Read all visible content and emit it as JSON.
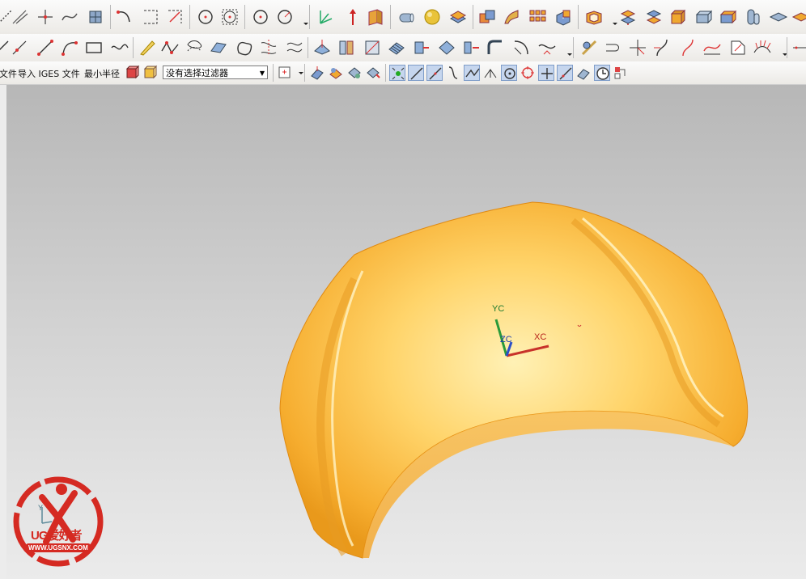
{
  "toolbar3": {
    "label_file": "文件",
    "label_import_iges": "导入 IGES 文件",
    "label_min_radius": "最小半径",
    "filter_value": "没有选择过滤器"
  },
  "viewport": {
    "axis_yc": "YC",
    "axis_xc": "XC",
    "axis_zc": "ZC",
    "model_color": "#ffb833"
  },
  "watermark": {
    "brand": "UG爱好者",
    "url": "WWW.UGSNX.COM",
    "axis_y": "Y"
  }
}
